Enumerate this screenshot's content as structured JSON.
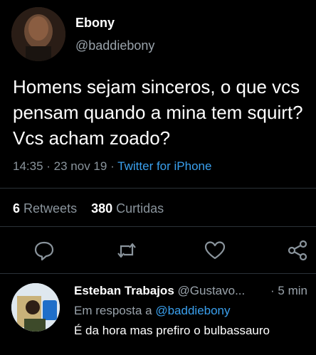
{
  "tweet": {
    "author_name": "Ebony",
    "author_handle": "@baddiebony",
    "text": "Homens sejam sinceros, o que vcs pensam quando a mina tem squirt? Vcs acham zoado?",
    "time": "14:35",
    "date": "23 nov 19",
    "source": "Twitter for iPhone",
    "retweets_count": "6",
    "retweets_label": "Retweets",
    "likes_count": "380",
    "likes_label": "Curtidas"
  },
  "actions": {
    "reply_icon": "reply-icon",
    "retweet_icon": "retweet-icon",
    "like_icon": "heart-icon",
    "share_icon": "share-icon"
  },
  "reply": {
    "author_name": "Esteban Trabajos",
    "author_handle": "@Gustavo...",
    "time": "5 min",
    "in_reply_to_label": "Em resposta a",
    "in_reply_to_handle": "@baddiebony",
    "text": "É da hora mas prefiro o bulbassauro"
  },
  "colors": {
    "background": "#000000",
    "link": "#3aa0ee",
    "secondary_text": "#9aa3ab",
    "icon": "#8a949c"
  }
}
